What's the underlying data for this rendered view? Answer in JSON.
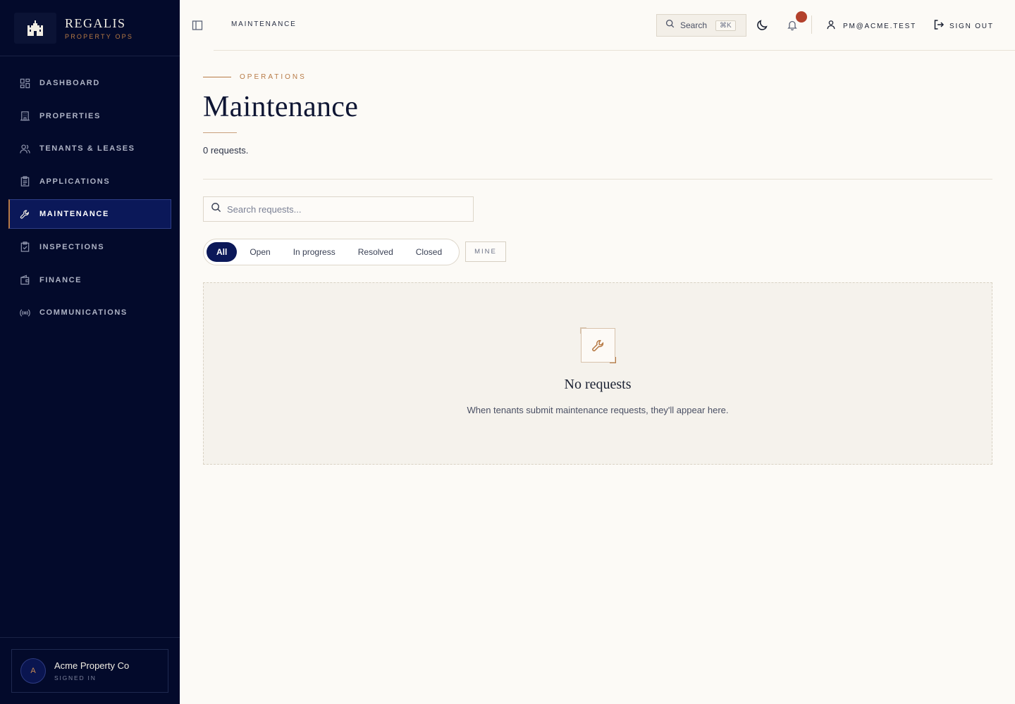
{
  "brand": {
    "name": "REGALIS",
    "subtitle": "PROPERTY OPS"
  },
  "sidebar": {
    "items": [
      {
        "label": "DASHBOARD",
        "icon": "grid-icon",
        "active": false
      },
      {
        "label": "PROPERTIES",
        "icon": "building-icon",
        "active": false
      },
      {
        "label": "TENANTS & LEASES",
        "icon": "users-icon",
        "active": false
      },
      {
        "label": "APPLICATIONS",
        "icon": "clipboard-icon",
        "active": false
      },
      {
        "label": "MAINTENANCE",
        "icon": "wrench-icon",
        "active": true
      },
      {
        "label": "INSPECTIONS",
        "icon": "clipboard-check-icon",
        "active": false
      },
      {
        "label": "FINANCE",
        "icon": "wallet-icon",
        "active": false
      },
      {
        "label": "COMMUNICATIONS",
        "icon": "broadcast-icon",
        "active": false
      }
    ],
    "account": {
      "initial": "A",
      "name": "Acme Property Co",
      "status": "SIGNED IN"
    }
  },
  "topbar": {
    "breadcrumb": "MAINTENANCE",
    "search_label": "Search",
    "search_shortcut": "⌘K",
    "user_email": "PM@ACME.TEST",
    "signout_label": "SIGN OUT"
  },
  "page": {
    "eyebrow": "OPERATIONS",
    "title": "Maintenance",
    "count_text": "0 requests.",
    "search_placeholder": "Search requests...",
    "filters": [
      "All",
      "Open",
      "In progress",
      "Resolved",
      "Closed"
    ],
    "active_filter": "All",
    "mine_label": "MINE",
    "empty_title": "No requests",
    "empty_text": "When tenants submit maintenance requests, they'll appear here."
  },
  "colors": {
    "sidebar_bg": "#030a2b",
    "accent_gold": "#b77a45",
    "active_navy": "#0b1859",
    "page_bg": "#fcfaf6",
    "notification": "#b3412c"
  }
}
